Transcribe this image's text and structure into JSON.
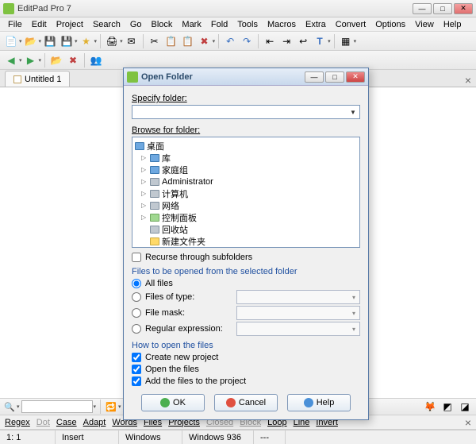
{
  "window": {
    "title": "EditPad Pro 7"
  },
  "menu": [
    "File",
    "Edit",
    "Project",
    "Search",
    "Go",
    "Block",
    "Mark",
    "Fold",
    "Tools",
    "Macros",
    "Extra",
    "Convert",
    "Options",
    "View",
    "Help"
  ],
  "tabs": [
    {
      "label": "Untitled 1"
    }
  ],
  "dialog": {
    "title": "Open Folder",
    "specify_label": "Specify folder:",
    "specify_value": "",
    "browse_label": "Browse for folder:",
    "tree": [
      {
        "label": "桌面",
        "icon": "blue",
        "root": true
      },
      {
        "label": "库",
        "icon": "blue"
      },
      {
        "label": "家庭组",
        "icon": "blue"
      },
      {
        "label": "Administrator",
        "icon": "grey"
      },
      {
        "label": "计算机",
        "icon": "grey"
      },
      {
        "label": "网络",
        "icon": "grey"
      },
      {
        "label": "控制面板",
        "icon": "green"
      },
      {
        "label": "回收站",
        "icon": "grey"
      },
      {
        "label": "新建文件夹",
        "icon": "yellow"
      }
    ],
    "recurse_label": "Recurse through subfolders",
    "recurse_checked": false,
    "section_files_label": "Files to be opened from the selected folder",
    "radio_all": "All files",
    "radio_type": "Files of type:",
    "radio_mask": "File mask:",
    "radio_regex": "Regular expression:",
    "radio_selected": "all",
    "section_how_label": "How to open the files",
    "chk_newproject": "Create new project",
    "chk_openfiles": "Open the files",
    "chk_addproject": "Add the files to the project",
    "btn_ok": "OK",
    "btn_cancel": "Cancel",
    "btn_help": "Help"
  },
  "optstrip": [
    "Regex",
    "Dot",
    "Case",
    "Adapt",
    "Words",
    "Files",
    "Projects",
    "Closed",
    "Block",
    "Loop",
    "Line",
    "Invert"
  ],
  "optstrip_dim": [
    1,
    7,
    8
  ],
  "status": {
    "pos": "1: 1",
    "insert": "Insert",
    "enc1": "Windows",
    "enc2": "Windows 936",
    "extra": "---"
  }
}
